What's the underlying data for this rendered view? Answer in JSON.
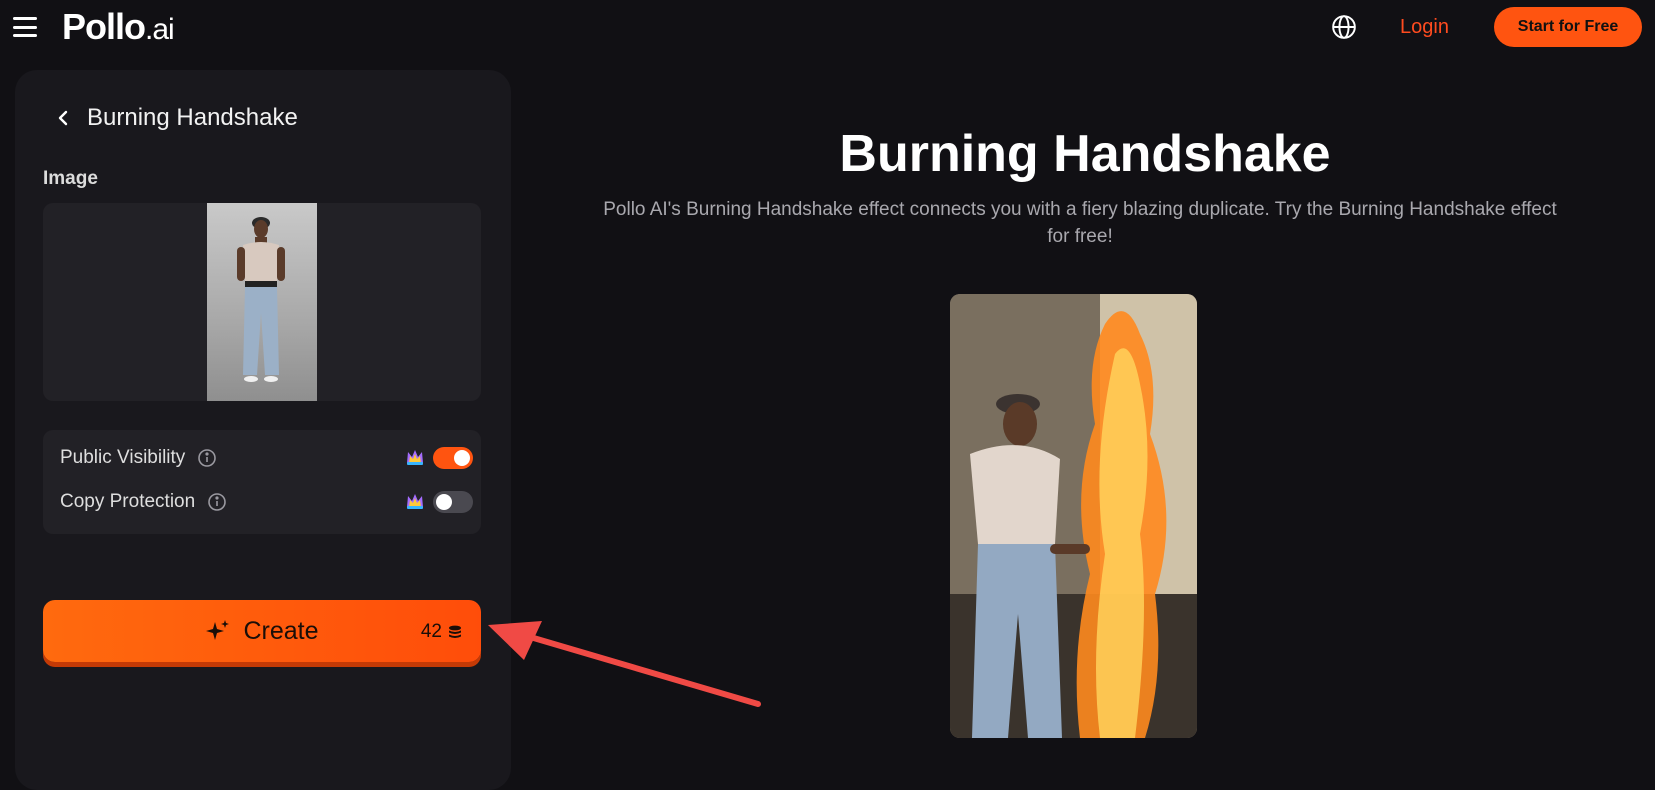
{
  "header": {
    "logo_main": "Pollo",
    "logo_suffix": ".ai",
    "login_label": "Login",
    "start_label": "Start for Free",
    "icons": [
      "menu-icon",
      "globe-icon"
    ]
  },
  "sidebar": {
    "title": "Burning Handshake",
    "image_label": "Image",
    "options": [
      {
        "label": "Public Visibility",
        "enabled": true
      },
      {
        "label": "Copy Protection",
        "enabled": false
      }
    ],
    "create_label": "Create",
    "credits": "42"
  },
  "main": {
    "title": "Burning Handshake",
    "description": "Pollo AI's Burning Handshake effect connects you with a fiery blazing duplicate. Try the Burning Handshake effect for free!"
  },
  "colors": {
    "accent": "#ff5410",
    "background": "#111014",
    "panel": "#19181d",
    "annotation_arrow": "#f04a45"
  }
}
